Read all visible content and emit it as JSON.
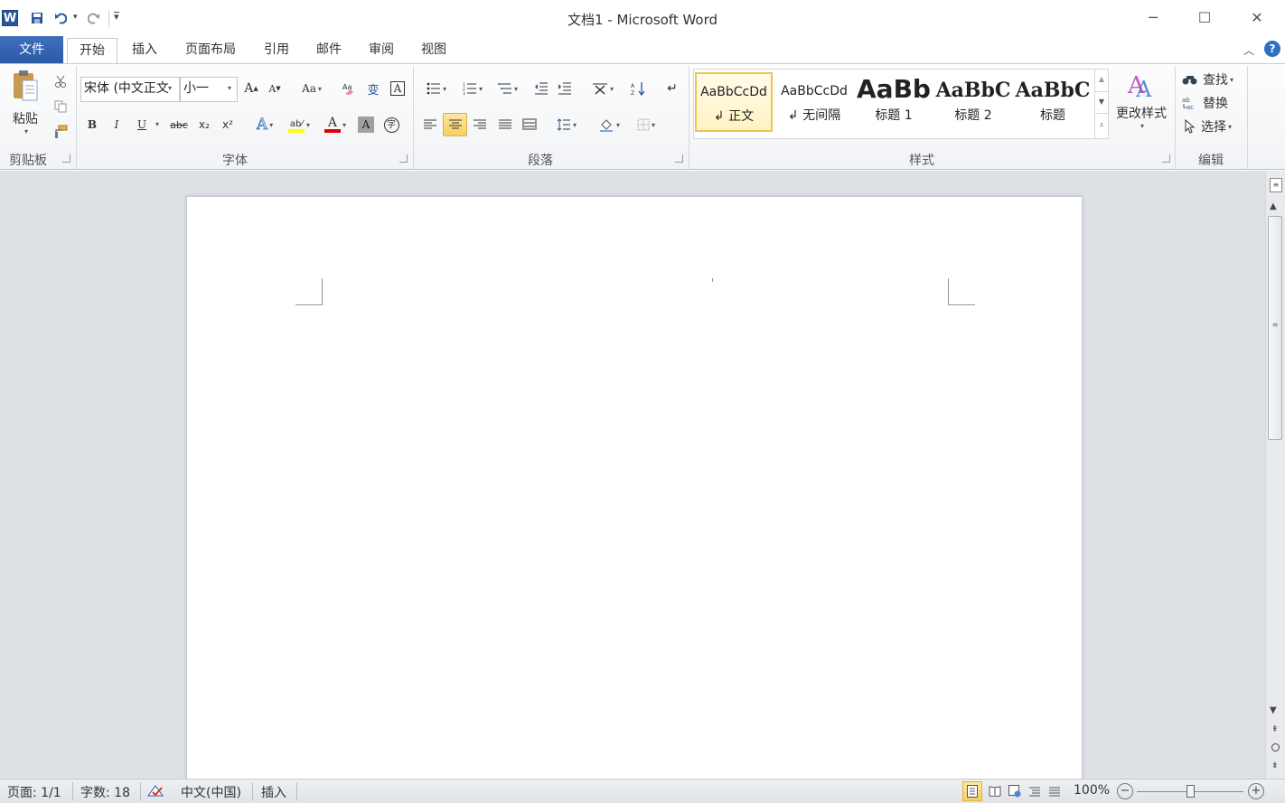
{
  "window": {
    "title": "文档1 - Microsoft Word",
    "minimize_glyph": "─",
    "maximize_glyph": "☐",
    "close_glyph": "✕"
  },
  "qat": {
    "app_icon": "W",
    "customize_glyph": "▾"
  },
  "tabs": {
    "file": "文件",
    "items": [
      "开始",
      "插入",
      "页面布局",
      "引用",
      "邮件",
      "审阅",
      "视图"
    ],
    "active": "开始"
  },
  "clipboard": {
    "paste_label": "粘贴",
    "group_label": "剪贴板"
  },
  "font": {
    "font_name": "宋体 (中文正文",
    "font_size": "小一",
    "grow_label": "A",
    "shrink_label": "A",
    "case_label": "Aa",
    "bold": "B",
    "italic": "I",
    "underline": "U",
    "strike": "abc",
    "sub": "x₂",
    "sup": "x²",
    "group_label": "字体"
  },
  "paragraph": {
    "group_label": "段落"
  },
  "styles": {
    "items": [
      {
        "sample": "AaBbCcDd",
        "name": "↲ 正文",
        "selected": true
      },
      {
        "sample": "AaBbCcDd",
        "name": "↲ 无间隔",
        "selected": false
      },
      {
        "sample": "AaBb",
        "name": "标题 1",
        "selected": false
      },
      {
        "sample": "AaBbC",
        "name": "标题 2",
        "selected": false
      },
      {
        "sample": "AaBbC",
        "name": "标题",
        "selected": false
      }
    ],
    "change_styles_label": "更改样式",
    "group_label": "样式"
  },
  "editing": {
    "find_label": "查找",
    "replace_label": "替换",
    "select_label": "选择",
    "group_label": "编辑"
  },
  "statusbar": {
    "page": "页面: 1/1",
    "words": "字数: 18",
    "language": "中文(中国)",
    "mode": "插入",
    "zoom": "100%"
  },
  "colors": {
    "accent": "#2b579a",
    "highlight": "#ffff00",
    "font_color": "#e00000",
    "selected_style_border": "#f2c34a"
  }
}
